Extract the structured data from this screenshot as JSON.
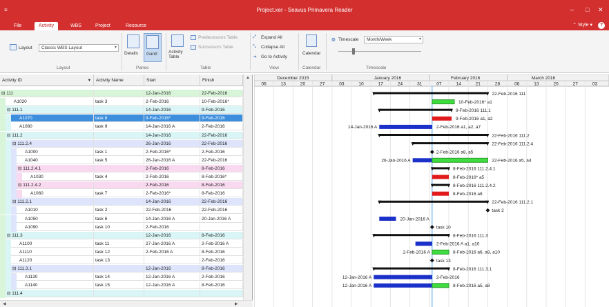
{
  "window": {
    "title": "Project.xer - Seavus Primavera Reader",
    "min": "‒",
    "max": "□",
    "close": "✕"
  },
  "tabs": [
    {
      "label": "File",
      "active": false
    },
    {
      "label": "Activity",
      "active": true
    },
    {
      "label": "WBS",
      "active": false
    },
    {
      "label": "Project",
      "active": false
    },
    {
      "label": "Resource",
      "active": false
    }
  ],
  "style_label": "Style",
  "help_label": "?",
  "ribbon": {
    "layout_label": "Layout",
    "layout_value": "Classic WBS Layout",
    "details_label": "Details",
    "gantt_label": "Gantt",
    "activity_table_label": "Activity Table",
    "predecessors_label": "Predecessors Table",
    "successors_label": "Successors Table",
    "expand_all": "Expand All",
    "collapse_all": "Collapse All",
    "go_to_activity": "Go to Activity",
    "calendar_label": "Calendar",
    "timescale_label": "Timescale",
    "timescale_value": "Month/Week",
    "groups": [
      "Layout",
      "Panes",
      "Table",
      "View",
      "Calendar",
      "Timescale"
    ]
  },
  "grid": {
    "columns": [
      "Activity ID",
      "Activity Name",
      "Start",
      "Finish"
    ],
    "rows": [
      {
        "id": "111",
        "name": "",
        "start": "12-Jan-2016",
        "finish": "22-Feb-2016",
        "level": 0,
        "wbs": true
      },
      {
        "id": "A1020",
        "name": "task 3",
        "start": "2-Feb-2016",
        "finish": "10-Feb-2016*",
        "level": 1,
        "wbs": false
      },
      {
        "id": "111.1",
        "name": "",
        "start": "14-Jan-2016",
        "finish": "9-Feb-2016",
        "level": 1,
        "wbs": true
      },
      {
        "id": "A1070",
        "name": "task 8",
        "start": "9-Feb-2016*",
        "finish": "9-Feb-2016",
        "level": 2,
        "wbs": false,
        "selected": true
      },
      {
        "id": "A1080",
        "name": "task 9",
        "start": "14-Jan-2016 A",
        "finish": "2-Feb-2016",
        "level": 2,
        "wbs": false
      },
      {
        "id": "111.2",
        "name": "",
        "start": "14-Jan-2016",
        "finish": "22-Feb-2016",
        "level": 1,
        "wbs": true
      },
      {
        "id": "111.2.4",
        "name": "",
        "start": "26-Jan-2016",
        "finish": "22-Feb-2016",
        "level": 2,
        "wbs": true
      },
      {
        "id": "A1000",
        "name": "task 1",
        "start": "2-Feb-2016*",
        "finish": "2-Feb-2016",
        "level": 3,
        "wbs": false
      },
      {
        "id": "A1040",
        "name": "task 5",
        "start": "26-Jan-2016 A",
        "finish": "22-Feb-2016",
        "level": 3,
        "wbs": false
      },
      {
        "id": "111.2.4.1",
        "name": "",
        "start": "2-Feb-2016",
        "finish": "8-Feb-2016",
        "level": 3,
        "wbs": true
      },
      {
        "id": "A1030",
        "name": "task 4",
        "start": "2-Feb-2016",
        "finish": "8-Feb-2016*",
        "level": 4,
        "wbs": false
      },
      {
        "id": "111.2.4.2",
        "name": "",
        "start": "2-Feb-2016",
        "finish": "8-Feb-2016",
        "level": 3,
        "wbs": true
      },
      {
        "id": "A1060",
        "name": "task 7",
        "start": "2-Feb-2016*",
        "finish": "8-Feb-2016",
        "level": 4,
        "wbs": false
      },
      {
        "id": "111.2.1",
        "name": "",
        "start": "14-Jan-2016",
        "finish": "22-Feb-2016",
        "level": 2,
        "wbs": true
      },
      {
        "id": "A1010",
        "name": "task 2",
        "start": "22-Feb-2016",
        "finish": "22-Feb-2016",
        "level": 3,
        "wbs": false
      },
      {
        "id": "A1050",
        "name": "task 6",
        "start": "14-Jan-2016 A",
        "finish": "20-Jan-2016 A",
        "level": 3,
        "wbs": false
      },
      {
        "id": "A1090",
        "name": "task 10",
        "start": "2-Feb-2016",
        "finish": "",
        "level": 3,
        "wbs": false
      },
      {
        "id": "111.3",
        "name": "",
        "start": "12-Jan-2016",
        "finish": "8-Feb-2016",
        "level": 1,
        "wbs": true
      },
      {
        "id": "A1100",
        "name": "task 11",
        "start": "27-Jan-2016 A",
        "finish": "2-Feb-2016 A",
        "level": 2,
        "wbs": false
      },
      {
        "id": "A1110",
        "name": "task 12",
        "start": "2-Feb-2016 A",
        "finish": "8-Feb-2016",
        "level": 2,
        "wbs": false
      },
      {
        "id": "A1120",
        "name": "task 13",
        "start": "",
        "finish": "2-Feb-2016",
        "level": 2,
        "wbs": false
      },
      {
        "id": "111.3.1",
        "name": "",
        "start": "12-Jan-2016",
        "finish": "8-Feb-2016",
        "level": 2,
        "wbs": true
      },
      {
        "id": "A1130",
        "name": "task 14",
        "start": "12-Jan-2016 A",
        "finish": "2-Feb-2016",
        "level": 3,
        "wbs": false
      },
      {
        "id": "A1140",
        "name": "task 15",
        "start": "12-Jan-2016 A",
        "finish": "8-Feb-2016",
        "level": 3,
        "wbs": false
      },
      {
        "id": "111.4",
        "name": "",
        "start": "",
        "finish": "",
        "level": 1,
        "wbs": true
      }
    ]
  },
  "gantt": {
    "months": [
      "December 2015",
      "January 2016",
      "February 2016",
      "March 2016"
    ],
    "weeks": [
      "06",
      "13",
      "20",
      "27",
      "03",
      "10",
      "17",
      "24",
      "31",
      "07",
      "14",
      "21",
      "28",
      "06",
      "13",
      "20",
      "27",
      "03"
    ],
    "data_date": "2-Feb-2016",
    "bars": [
      {
        "row": 0,
        "type": "summary",
        "start": "12-Jan-2016",
        "finish": "22-Feb-2016",
        "label_right": "22-Feb-2016  111"
      },
      {
        "row": 1,
        "type": "remaining",
        "start": "2-Feb-2016",
        "finish": "10-Feb-2016",
        "label_right": "10-Feb-2016*  a1"
      },
      {
        "row": 2,
        "type": "summary",
        "start": "14-Jan-2016",
        "finish": "9-Feb-2016",
        "label_right": "9-Feb-2016  111.1"
      },
      {
        "row": 3,
        "type": "critical",
        "start": "2-Feb-2016",
        "finish": "9-Feb-2016",
        "label_right": "9-Feb-2016  a1, a2"
      },
      {
        "row": 4,
        "type": "actual",
        "start": "14-Jan-2016",
        "finish": "2-Feb-2016",
        "label_left": "14-Jan-2016 A",
        "label_right": "2-Feb-2016  a1, a2, a7"
      },
      {
        "row": 5,
        "type": "summary",
        "start": "14-Jan-2016",
        "finish": "22-Feb-2016",
        "label_right": "22-Feb-2016  111.2"
      },
      {
        "row": 6,
        "type": "summary",
        "start": "26-Jan-2016",
        "finish": "22-Feb-2016",
        "label_right": "22-Feb-2016  111.2.4"
      },
      {
        "row": 7,
        "type": "milestone",
        "start": "2-Feb-2016",
        "finish": "2-Feb-2016",
        "label_right": "2-Feb-2016  a8, a5"
      },
      {
        "row": 8,
        "type": "actual_remaining",
        "start": "26-Jan-2016",
        "finish": "22-Feb-2016",
        "label_left": "26-Jan-2016 A",
        "label_right": "22-Feb-2016  a5, a4"
      },
      {
        "row": 9,
        "type": "summary",
        "start": "2-Feb-2016",
        "finish": "8-Feb-2016",
        "label_right": "8-Feb-2016  111.2.4.1"
      },
      {
        "row": 10,
        "type": "critical",
        "start": "2-Feb-2016",
        "finish": "8-Feb-2016",
        "label_right": "8-Feb-2016*  a5"
      },
      {
        "row": 11,
        "type": "summary",
        "start": "2-Feb-2016",
        "finish": "8-Feb-2016",
        "label_right": "8-Feb-2016  111.2.4.2"
      },
      {
        "row": 12,
        "type": "critical",
        "start": "2-Feb-2016",
        "finish": "8-Feb-2016",
        "label_right": "8-Feb-2016  a8"
      },
      {
        "row": 13,
        "type": "summary",
        "start": "14-Jan-2016",
        "finish": "22-Feb-2016",
        "label_right": "22-Feb-2016  111.2.1"
      },
      {
        "row": 14,
        "type": "milestone",
        "start": "22-Feb-2016",
        "finish": "22-Feb-2016",
        "label_right": "task 2"
      },
      {
        "row": 15,
        "type": "actual",
        "start": "14-Jan-2016",
        "finish": "20-Jan-2016",
        "label_right": "20-Jan-2016 A"
      },
      {
        "row": 16,
        "type": "milestone",
        "start": "2-Feb-2016",
        "finish": "2-Feb-2016",
        "label_right": "task 10"
      },
      {
        "row": 17,
        "type": "summary",
        "start": "12-Jan-2016",
        "finish": "8-Feb-2016",
        "label_right": "8-Feb-2016  111.3"
      },
      {
        "row": 18,
        "type": "actual",
        "start": "27-Jan-2016",
        "finish": "2-Feb-2016",
        "label_right": "2-Feb-2016 A  a1, a10"
      },
      {
        "row": 19,
        "type": "remaining",
        "start": "2-Feb-2016",
        "finish": "8-Feb-2016",
        "label_left": "2-Feb-2016 A",
        "label_right": "8-Feb-2016  a6, a9, a10"
      },
      {
        "row": 20,
        "type": "milestone",
        "start": "2-Feb-2016",
        "finish": "2-Feb-2016",
        "label_right": "task 13"
      },
      {
        "row": 21,
        "type": "summary",
        "start": "12-Jan-2016",
        "finish": "8-Feb-2016",
        "label_right": "8-Feb-2016  111.3.1"
      },
      {
        "row": 22,
        "type": "actual",
        "start": "12-Jan-2016",
        "finish": "2-Feb-2016",
        "label_left": "12-Jan-2016 A",
        "label_right": "2-Feb-2016"
      },
      {
        "row": 23,
        "type": "actual_remaining",
        "start": "12-Jan-2016",
        "finish": "8-Feb-2016",
        "label_left": "12-Jan-2016 A",
        "label_right": "8-Feb-2016  a5, a8"
      }
    ]
  },
  "colors": {
    "title_bar": "#d32f2f",
    "wbs_level0": "#d9f5d9",
    "wbs_level1": "#d9f5f5",
    "wbs_level2": "#dde4fb",
    "wbs_level3": "#f9d9ef",
    "selected": "#3d8fdd",
    "actual_bar": "#1b2fc9",
    "remaining_bar": "#3fdc3f",
    "critical_bar": "#e11b1b",
    "summary_bar": "#111111",
    "data_date_line": "#4aa0e8"
  }
}
